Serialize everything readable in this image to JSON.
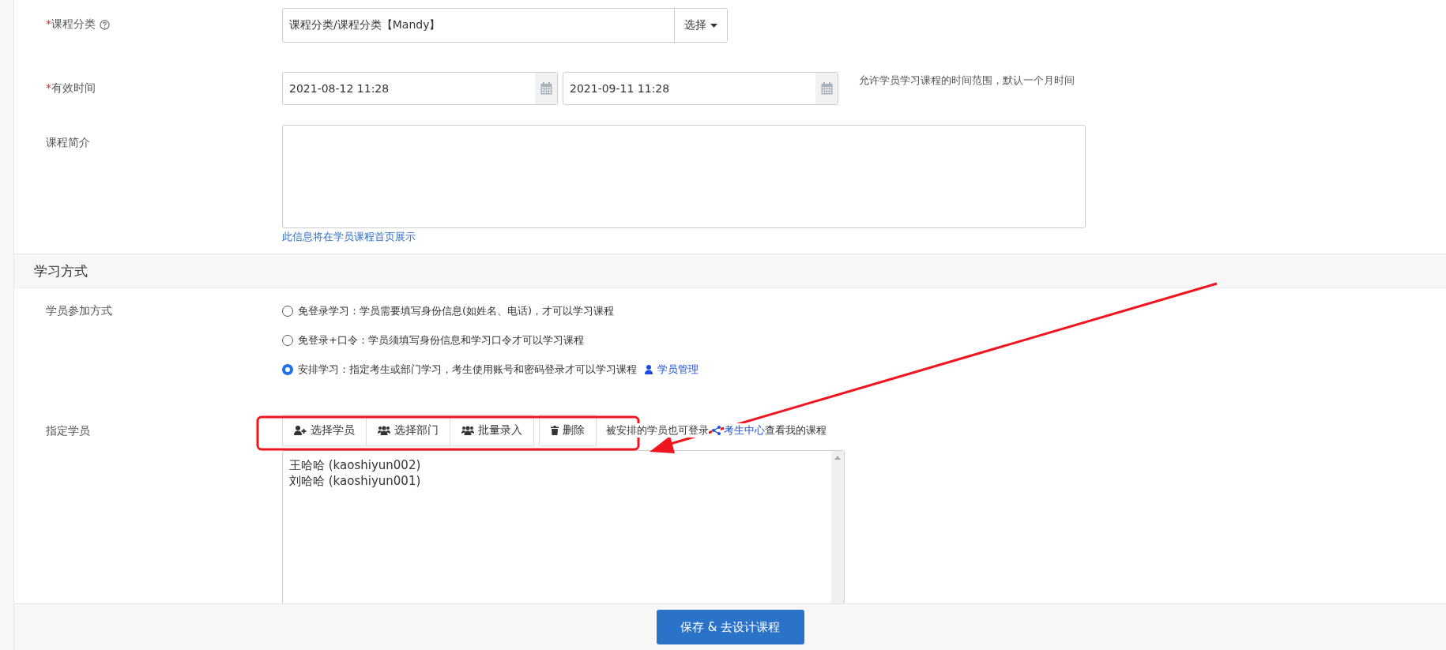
{
  "fields": [
    {
      "kind": "select",
      "label": "课程分类",
      "marker": "*",
      "help": true,
      "value": "课程分类/课程分类【Mandy】",
      "button": "选择"
    },
    {
      "kind": "daterange",
      "label": "有效时间",
      "marker": "*",
      "start": "2021-08-12 11:28",
      "end": "2021-09-11 11:28",
      "hint": "允许学员学习课程的时间范围，默认一个月时间"
    },
    {
      "kind": "textarea",
      "label": "课程简介",
      "note": "此信息将在学员课程首页展示"
    }
  ],
  "section": {
    "title": "学习方式"
  },
  "join_mode": {
    "label": "学员参加方式",
    "options": [
      {
        "text": "免登录学习：学员需要填写身份信息(如姓名、电话)，才可以学习课程",
        "selected": false
      },
      {
        "text": "免登录+口令：学员须填写身份信息和学习口令才可以学习课程",
        "selected": false
      },
      {
        "text": "安排学习：指定考生或部门学习，考生使用账号和密码登录才可以学习课程",
        "selected": true,
        "link": "学员管理"
      }
    ]
  },
  "assign": {
    "label": "指定学员",
    "buttons": [
      {
        "kind": "add-person",
        "label": "选择学员"
      },
      {
        "kind": "group",
        "label": "选择部门"
      },
      {
        "kind": "import",
        "label": "批量录入"
      },
      {
        "kind": "delete",
        "label": "删除"
      }
    ],
    "note": "被安排的学员也可登录",
    "link": "考生中心",
    "note_end": "查看我的课程",
    "students": [
      "王哈哈 (kaoshiyun002)",
      "刘哈哈 (kaoshiyun001)"
    ]
  },
  "footer": {
    "button": "保存 & 去设计课程"
  }
}
